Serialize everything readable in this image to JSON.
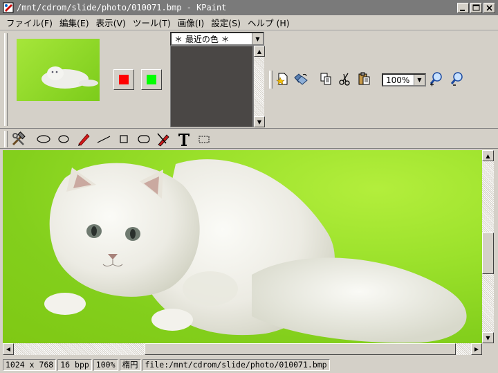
{
  "window": {
    "title": "/mnt/cdrom/slide/photo/010071.bmp - KPaint"
  },
  "menu": [
    {
      "label": "ファイル(F)"
    },
    {
      "label": "編集(E)"
    },
    {
      "label": "表示(V)"
    },
    {
      "label": "ツール(T)"
    },
    {
      "label": "画像(I)"
    },
    {
      "label": "設定(S)"
    },
    {
      "label": "ヘルプ (H)"
    }
  ],
  "palette": {
    "left_color": "#ff0000",
    "right_color": "#00ff00",
    "recent_colors_label": "＊ 最近の色 ＊"
  },
  "zoom": {
    "value": "100%"
  },
  "status": {
    "dimensions": "1024 x 768",
    "depth": "16 bpp",
    "zoom": "100%",
    "input_mode": "楕円",
    "file": "file:/mnt/cdrom/slide/photo/010071.bmp"
  },
  "colors": {
    "canvas_green": "#8fd822",
    "title_bg": "#7a7a7a"
  }
}
